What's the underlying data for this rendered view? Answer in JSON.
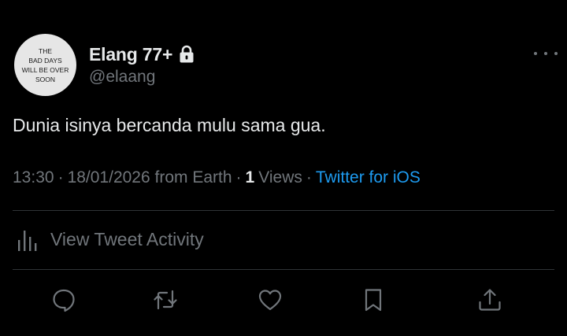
{
  "tweet": {
    "avatar_text": "THE\nBAD DAYS\nWILL BE OVER\nSOON",
    "display_name": "Elang 77+",
    "handle": "@elaang",
    "text": "Dunia isinya bercanda mulu sama gua.",
    "time": "13:30",
    "date": "18/01/2026 from Earth",
    "separator": "·",
    "views_count": "1",
    "views_label": "Views",
    "source": "Twitter for iOS",
    "activity_label": "View Tweet Activity"
  },
  "icons": {
    "lock": "lock-icon",
    "more": "more-icon",
    "activity": "bar-chart-icon",
    "reply": "reply-icon",
    "retweet": "retweet-icon",
    "like": "heart-icon",
    "bookmark": "bookmark-icon",
    "share": "share-icon"
  },
  "colors": {
    "background": "#000000",
    "primary_text": "#e7e9ea",
    "secondary_text": "#71767b",
    "link": "#1d9bf0",
    "divider": "#2f3336"
  }
}
